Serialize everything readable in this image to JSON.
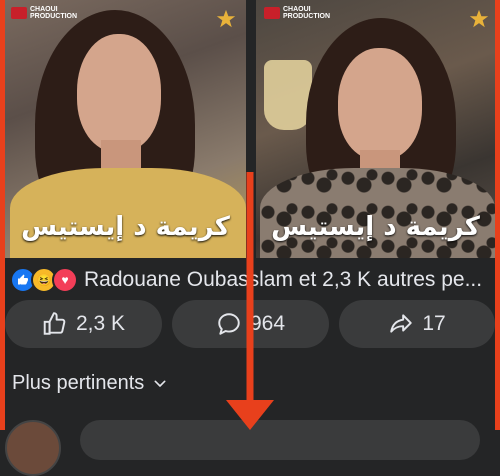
{
  "post": {
    "left_image": {
      "logo_text": "CHAOUI\nPRODUCTION",
      "caption": "كريمة د إيستيس"
    },
    "right_image": {
      "logo_text": "CHAOUI\nPRODUCTION",
      "caption": "كريمة د إيستيس"
    }
  },
  "reactions": {
    "summary": "Radouane Oubasslam et 2,3 K autres pe...",
    "types": [
      "like-icon",
      "haha-icon",
      "love-icon"
    ]
  },
  "actions": {
    "like_count": "2,3 K",
    "comment_count": "964",
    "share_count": "17"
  },
  "comments": {
    "sort_label": "Plus pertinents"
  },
  "colors": {
    "background": "#242526",
    "pill": "#3a3b3c",
    "annotation_red": "#e8401c",
    "like_blue": "#1877f2"
  }
}
